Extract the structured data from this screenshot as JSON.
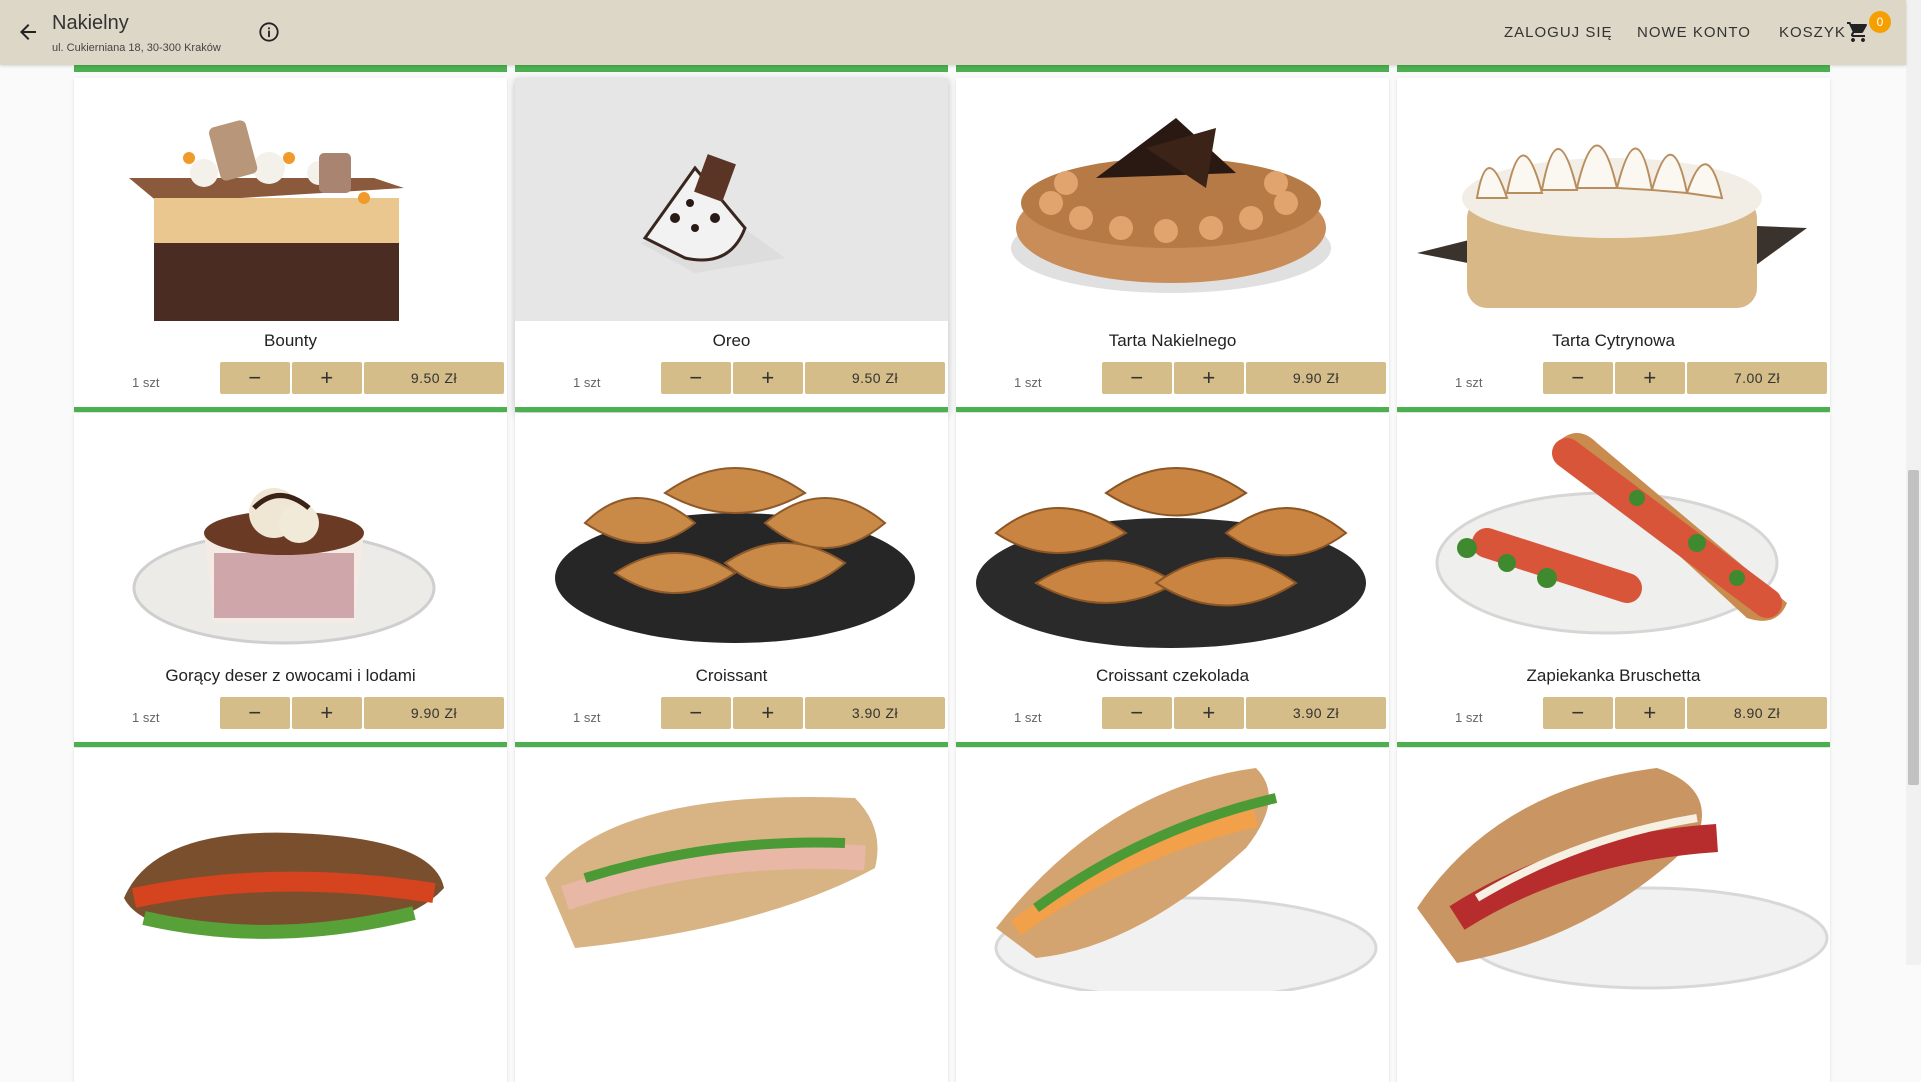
{
  "header": {
    "name": "Nakielny",
    "address": "ul. Cukierniana 18, 30-300 Kraków",
    "login": "ZALOGUJ SIĘ",
    "register": "NOWE KONTO",
    "cart": "KOSZYK",
    "cart_count": "0"
  },
  "products": [
    {
      "name": "Bounty",
      "qty": "1 szt",
      "price": "9.50 Zł"
    },
    {
      "name": "Oreo",
      "qty": "1 szt",
      "price": "9.50 Zł"
    },
    {
      "name": "Tarta Nakielnego",
      "qty": "1 szt",
      "price": "9.90 Zł"
    },
    {
      "name": "Tarta Cytrynowa",
      "qty": "1 szt",
      "price": "7.00 Zł"
    },
    {
      "name": "Gorący deser z owocami i lodami",
      "qty": "1 szt",
      "price": "9.90 Zł"
    },
    {
      "name": "Croissant",
      "qty": "1 szt",
      "price": "3.90 Zł"
    },
    {
      "name": "Croissant czekolada",
      "qty": "1 szt",
      "price": "3.90 Zł"
    },
    {
      "name": "Zapiekanka Bruschetta",
      "qty": "1 szt",
      "price": "8.90 Zł"
    }
  ],
  "colors": {
    "header_bg": "#ddd7c8",
    "button_bg": "#d4bd88",
    "accent_green": "#4caf50",
    "badge": "#f5a000"
  }
}
